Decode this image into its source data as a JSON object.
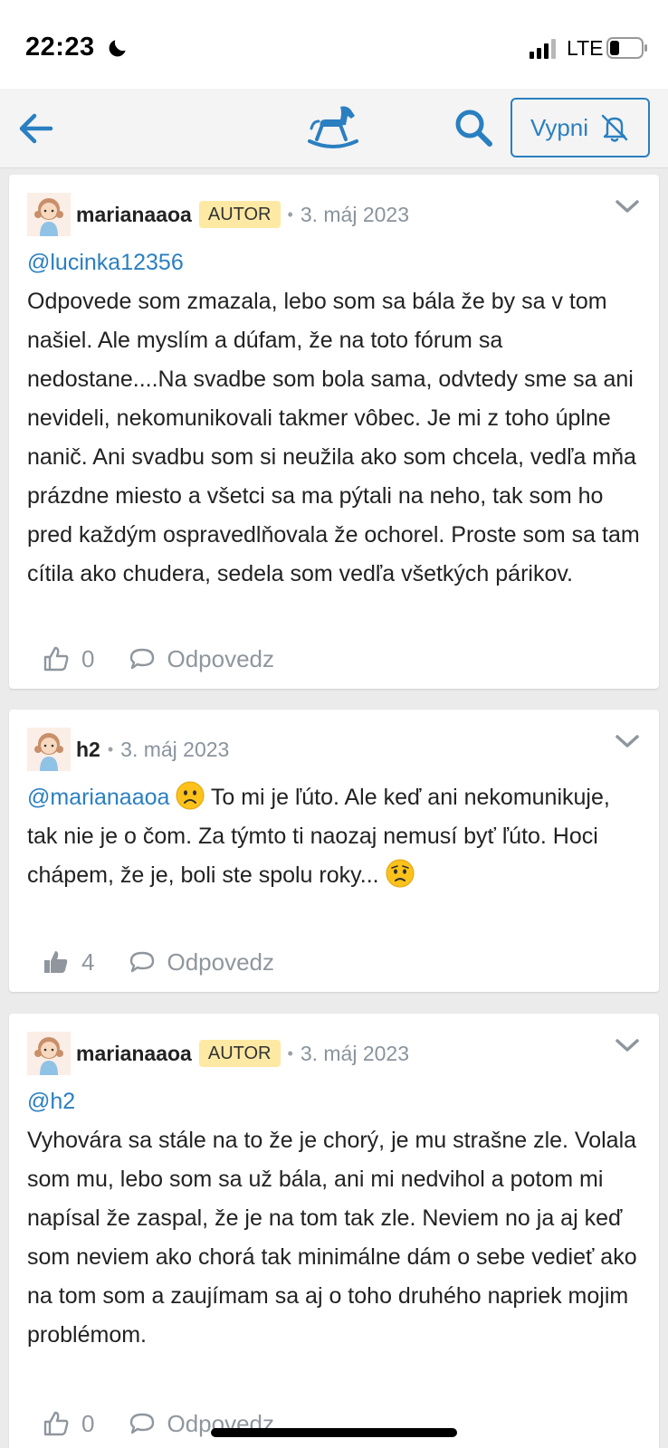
{
  "status_bar": {
    "time": "22:23",
    "network": "LTE",
    "icons": [
      "moon-icon",
      "signal-icon",
      "battery-icon"
    ]
  },
  "header": {
    "back_icon": "arrow-left-icon",
    "logo_icon": "rocking-horse-icon",
    "search_icon": "search-icon",
    "mute_button_label": "Vypni",
    "mute_icon": "bell-off-icon"
  },
  "colors": {
    "accent": "#2a7fc1",
    "badge_bg": "#fde9a3",
    "page_bg": "#ebebeb",
    "muted": "#8f969d"
  },
  "posts": [
    {
      "author": "marianaaoa",
      "badge": "AUTOR",
      "date": "3. máj 2023",
      "mention": "@lucinka12356",
      "text": "Odpovede som zmazala, lebo som sa bála že by sa v tom našiel. Ale myslím a dúfam, že na toto fórum sa nedostane....Na svadbe som bola sama, odvtedy sme sa ani nevideli, nekomunikovali takmer vôbec. Je mi z toho úplne nanič. Ani svadbu som si neužila ako som chcela, vedľa mňa prázdne miesto a všetci sa ma pýtali na neho, tak som ho pred každým ospravedlňovala že ochorel. Proste som sa tam cítila ako chudera, sedela som vedľa všetkých párikov.",
      "likes": "0",
      "liked": false,
      "reply_label": "Odpovedz"
    },
    {
      "author": "h2",
      "date": "3. máj 2023",
      "mention": "@marianaaoa",
      "text_part1": "To mi je ľúto. Ale keď ani nekomunikuje, tak nie je o čom. Za týmto ti naozaj nemusí byť ľúto. Hoci chápem, že je, boli ste spolu roky...",
      "emoji1": "frowning-face-emoji",
      "emoji2": "worried-face-emoji",
      "likes": "4",
      "liked": true,
      "reply_label": "Odpovedz"
    },
    {
      "author": "marianaaoa",
      "badge": "AUTOR",
      "date": "3. máj 2023",
      "mention": "@h2",
      "text": "Vyhovára sa stále na to že je chorý, je mu strašne zle. Volala som mu, lebo som sa už bála, ani mi nedvihol a potom mi napísal že zaspal, že je na tom tak zle. Neviem no ja aj keď som neviem ako chorá tak minimálne dám o sebe vedieť ako na tom som a zaujímam sa aj o toho druhého napriek mojim problémom.",
      "likes": "0",
      "reply_label": "Odpovedz"
    }
  ]
}
